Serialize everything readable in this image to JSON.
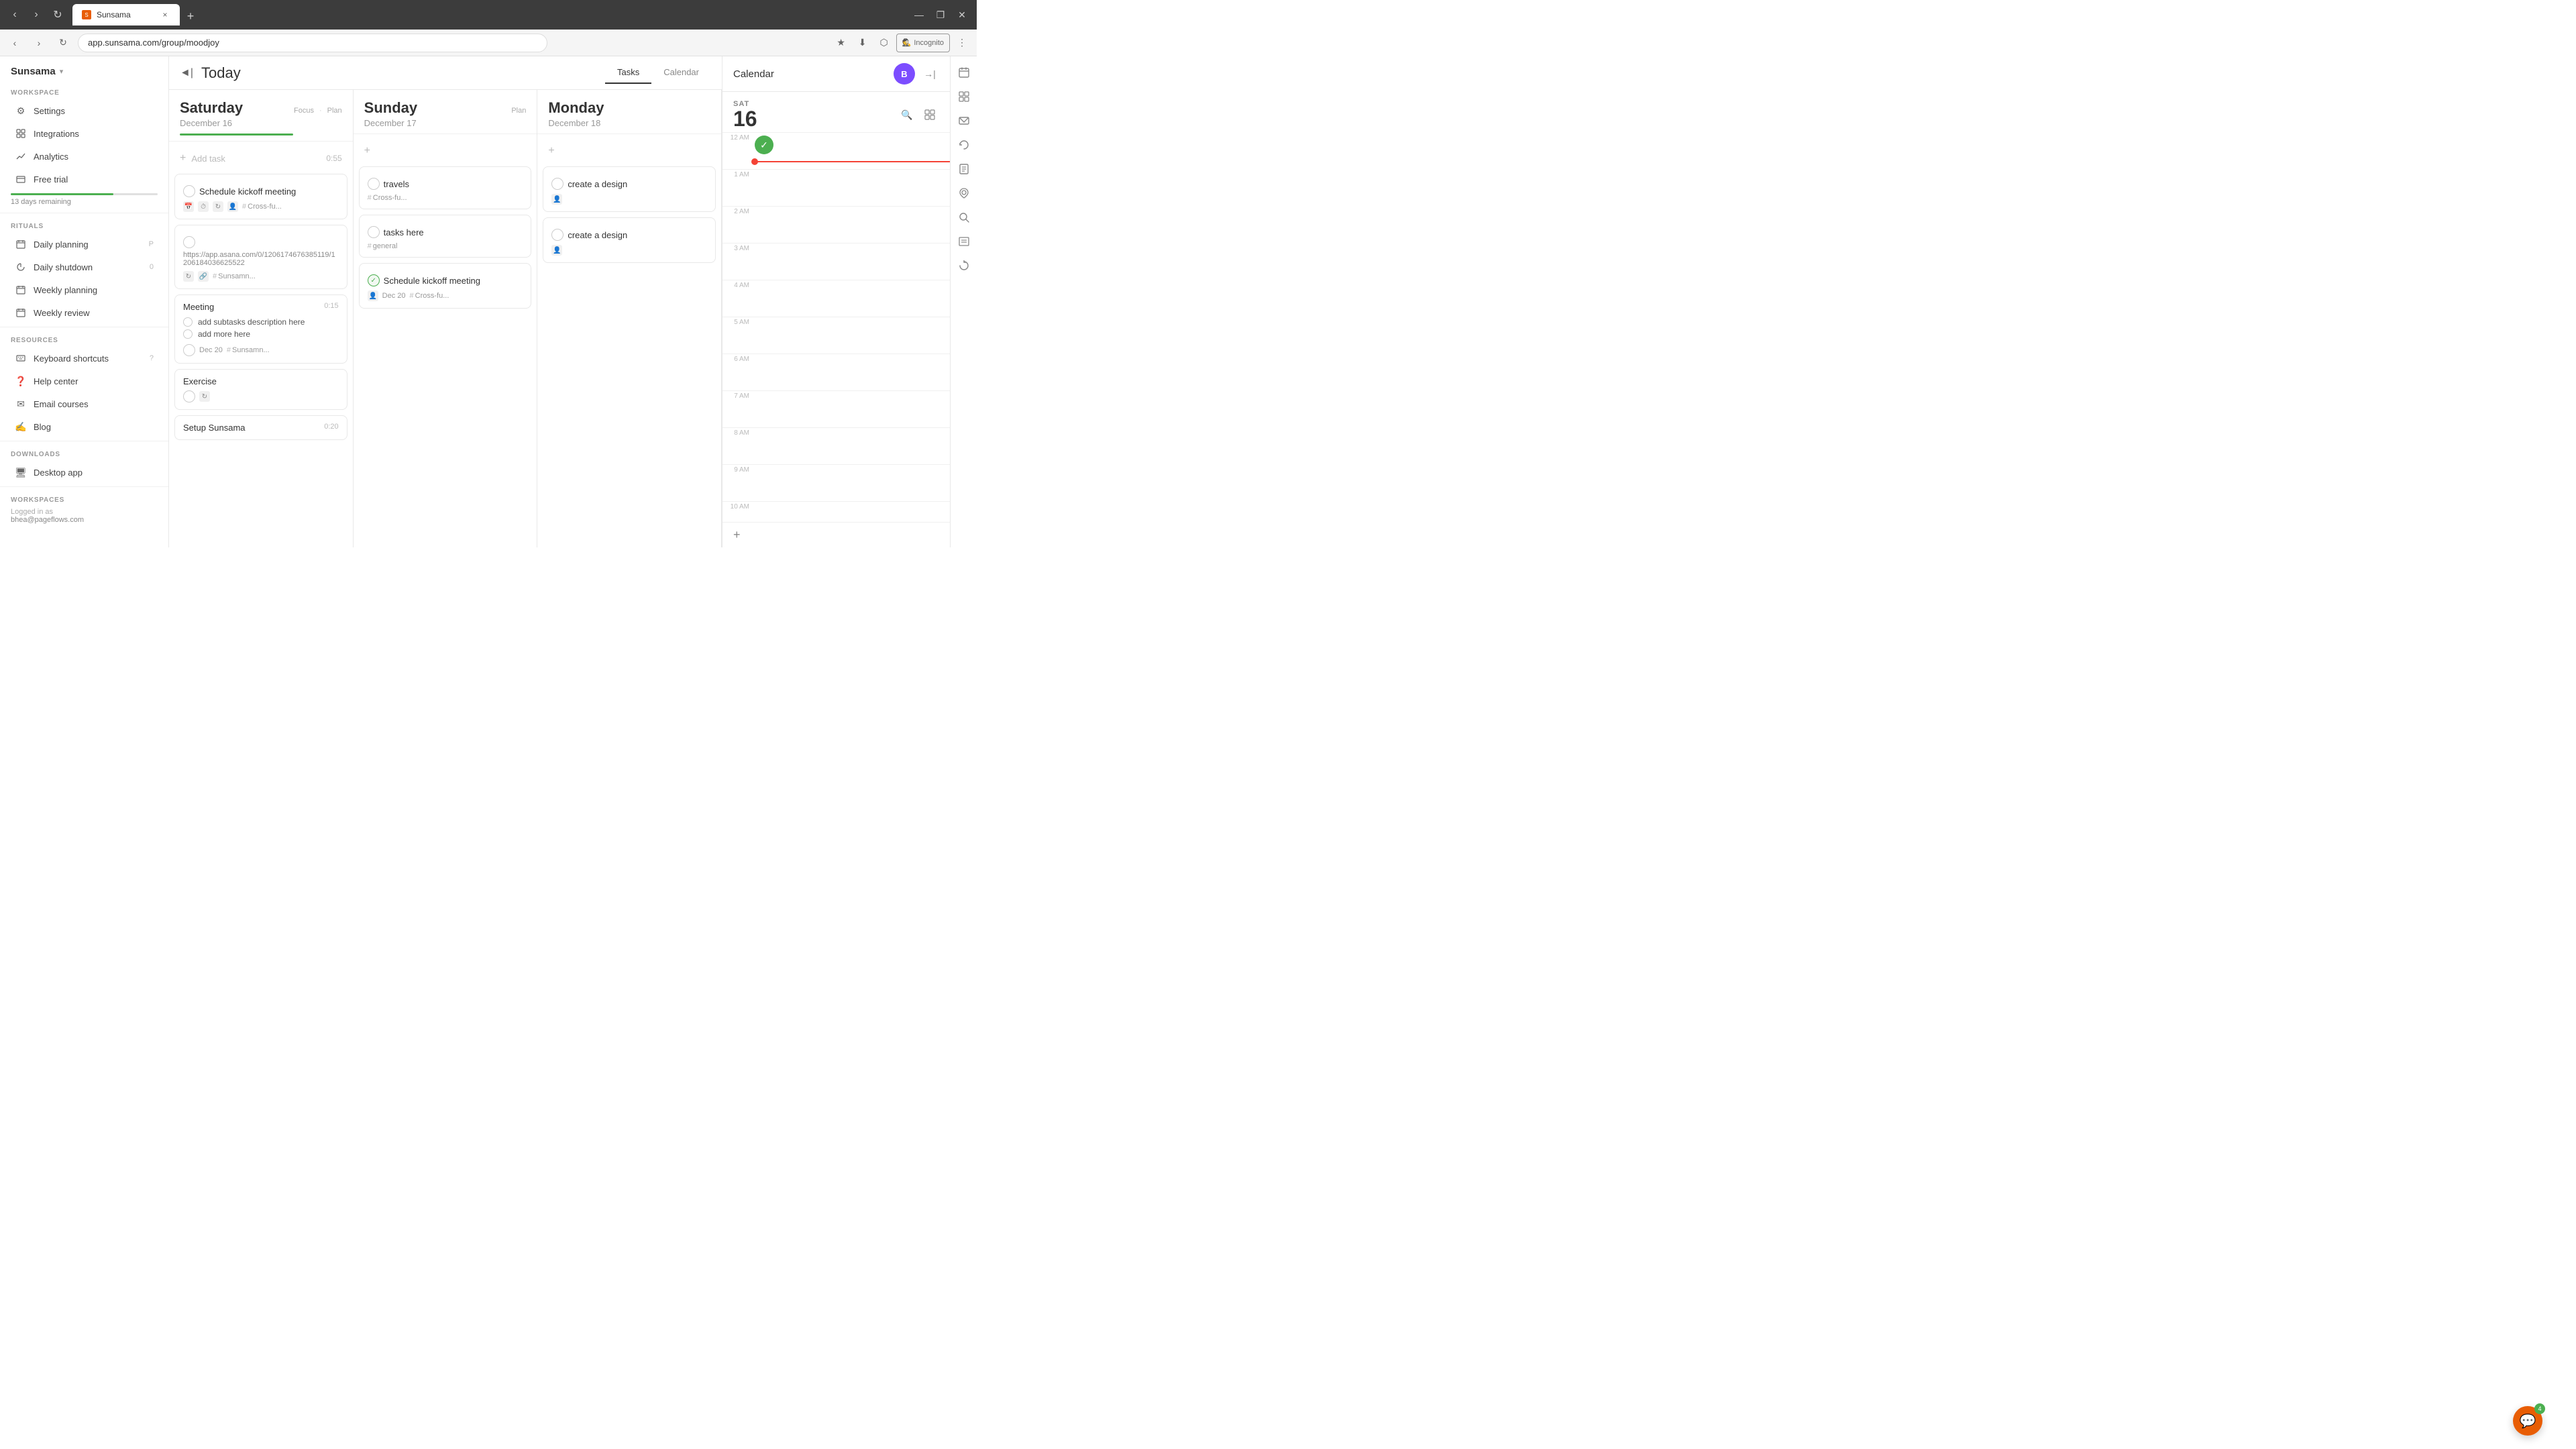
{
  "browser": {
    "tab_label": "Sunsama",
    "tab_close": "×",
    "url": "app.sunsama.com/group/moodjoy",
    "incognito_label": "Incognito",
    "new_tab": "+",
    "window_minimize": "—",
    "window_maximize": "❐",
    "window_close": "✕"
  },
  "sidebar": {
    "logo": "Sunsama",
    "workspace_label": "WORKSPACE",
    "settings_label": "Settings",
    "integrations_label": "Integrations",
    "analytics_label": "Analytics",
    "free_trial_label": "Free trial",
    "free_trial_days": "13 days remaining",
    "rituals_label": "RITUALS",
    "daily_planning_label": "Daily planning",
    "daily_planning_shortcut": "P",
    "daily_shutdown_label": "Daily shutdown",
    "daily_shutdown_shortcut": "0",
    "weekly_planning_label": "Weekly planning",
    "weekly_review_label": "Weekly review",
    "resources_label": "RESOURCES",
    "keyboard_shortcuts_label": "Keyboard shortcuts",
    "keyboard_shortcuts_shortcut": "?",
    "help_center_label": "Help center",
    "email_courses_label": "Email courses",
    "blog_label": "Blog",
    "downloads_label": "DOWNLOADS",
    "desktop_app_label": "Desktop app",
    "workspaces_label": "WORKSPACES",
    "logged_in_as": "Logged in as",
    "user_email": "bhea@pageflows.com"
  },
  "toolbar": {
    "today_label": "Today",
    "tab_tasks": "Tasks",
    "tab_calendar": "Calendar",
    "back_icon": "◄",
    "active_tab": "Tasks"
  },
  "days": [
    {
      "name": "Saturday",
      "date": "December 16",
      "actions": [
        "Focus",
        "Plan"
      ],
      "progress_width": "70%",
      "add_task_label": "Add task",
      "add_task_time": "0:55",
      "tasks": [
        {
          "id": "t1",
          "title": "Schedule kickoff meeting",
          "check": false,
          "icons": [
            "calendar",
            "clock",
            "recur",
            "people"
          ],
          "tag": "Cross-fu...",
          "timer": null
        },
        {
          "id": "t2",
          "title": "https://app.asana.com/0/1206174676385119/1206184036625522",
          "is_url": true,
          "check": false,
          "icons": [
            "recur",
            "link"
          ],
          "tag": "Sunsamn...",
          "timer": null
        },
        {
          "id": "t3",
          "title": "Meeting",
          "check": false,
          "timer": "0:15",
          "subtasks": [
            "add subtasks description here",
            "add more here"
          ],
          "date": "Dec 20",
          "tag": "Sunsamn...",
          "icons": []
        },
        {
          "id": "t4",
          "title": "Exercise",
          "check": false,
          "icons": [
            "recur"
          ],
          "timer": null,
          "tag": null
        },
        {
          "id": "t5",
          "title": "Setup Sunsama",
          "check": false,
          "timer": "0:20",
          "tag": null
        }
      ]
    },
    {
      "name": "Sunday",
      "date": "December 17",
      "actions": [
        "Plan"
      ],
      "tasks": [
        {
          "id": "s1",
          "title": "travels",
          "check": false,
          "tag": "Cross-fu...",
          "icons": []
        },
        {
          "id": "s2",
          "title": "tasks here",
          "check": false,
          "tag": "general",
          "icons": []
        },
        {
          "id": "s3",
          "title": "Schedule kickoff meeting",
          "check": true,
          "tag": "Cross-fu...",
          "date": "Dec 20",
          "icons": [
            "people"
          ]
        }
      ]
    },
    {
      "name": "Monday",
      "date": "December 18",
      "actions": [],
      "tasks": [
        {
          "id": "m1",
          "title": "create a design",
          "check": false,
          "tag": null,
          "icons": [
            "people"
          ]
        },
        {
          "id": "m2",
          "title": "create a design",
          "check": false,
          "tag": null,
          "icons": [
            "people"
          ]
        }
      ]
    }
  ],
  "calendar_panel": {
    "title": "Calendar",
    "day_label": "SAT",
    "date_num": "16",
    "time_rows": [
      "12 AM",
      "1 AM",
      "2 AM",
      "3 AM",
      "4 AM",
      "5 AM",
      "6 AM",
      "7 AM",
      "8 AM",
      "9 AM",
      "10 AM"
    ],
    "add_label": "+"
  },
  "icons": {
    "back": "◄|",
    "settings": "⚙",
    "integrations": "⬡",
    "analytics": "📈",
    "free_trial": "☰",
    "daily_planning": "☰",
    "daily_shutdown": "🌙",
    "weekly_planning": "☰",
    "weekly_review": "☰",
    "keyboard": "⌨",
    "help": "❓",
    "email": "✉",
    "blog": "✍",
    "desktop": "🖥",
    "search": "🔍",
    "zoom": "🔍",
    "check": "✓",
    "plus": "+",
    "calendar_icon": "📅",
    "people": "👥",
    "recur": "↻",
    "clock": "⏱",
    "link": "🔗",
    "hash": "#",
    "star": "★",
    "download": "⬇",
    "extensions": "⬡",
    "menu": "⋮",
    "close_panel": "→|"
  }
}
